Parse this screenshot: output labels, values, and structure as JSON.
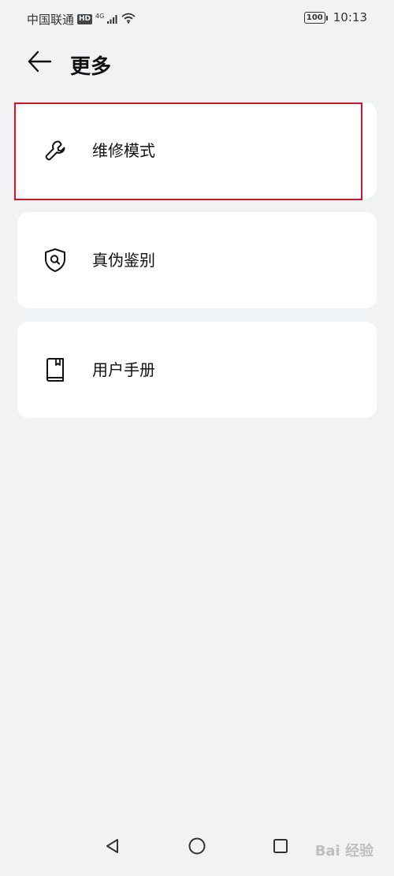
{
  "status_bar": {
    "carrier": "中国联通",
    "hd": "HD",
    "network": "4G",
    "battery": "100",
    "time": "10:13"
  },
  "header": {
    "title": "更多"
  },
  "menu": {
    "items": [
      {
        "label": "维修模式",
        "icon": "wrench-icon"
      },
      {
        "label": "真伪鉴别",
        "icon": "shield-search-icon"
      },
      {
        "label": "用户手册",
        "icon": "book-icon"
      }
    ]
  },
  "highlight_color": "#d0142c",
  "watermark": "Bai 经验"
}
